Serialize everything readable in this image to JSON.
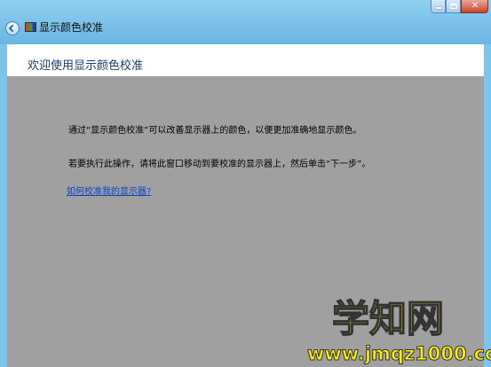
{
  "window": {
    "app_title": "显示颜色校准",
    "controls": {
      "minimize": "",
      "maximize": "",
      "close": "✕"
    }
  },
  "page": {
    "heading": "欢迎使用显示颜色校准",
    "paragraph_1": "通过“显示颜色校准”可以改善显示器上的颜色，以便更加准确地显示颜色。",
    "paragraph_2": "若要执行此操作，请将此窗口移动到要校准的显示器上，然后单击“下一步”。",
    "help_link": "如何校准我的显示器?"
  },
  "watermark": {
    "logo": "学知网",
    "url": "www.jmqz1000.com"
  },
  "colors": {
    "title_bar": "#7cc4ea",
    "content_bg": "#a0a0a0",
    "heading_text": "#1a3e73",
    "link": "#0645c8",
    "watermark_fill": "#ffee00"
  },
  "icons": {
    "back": "back-arrow-icon",
    "app": "color-calibration-icon"
  }
}
